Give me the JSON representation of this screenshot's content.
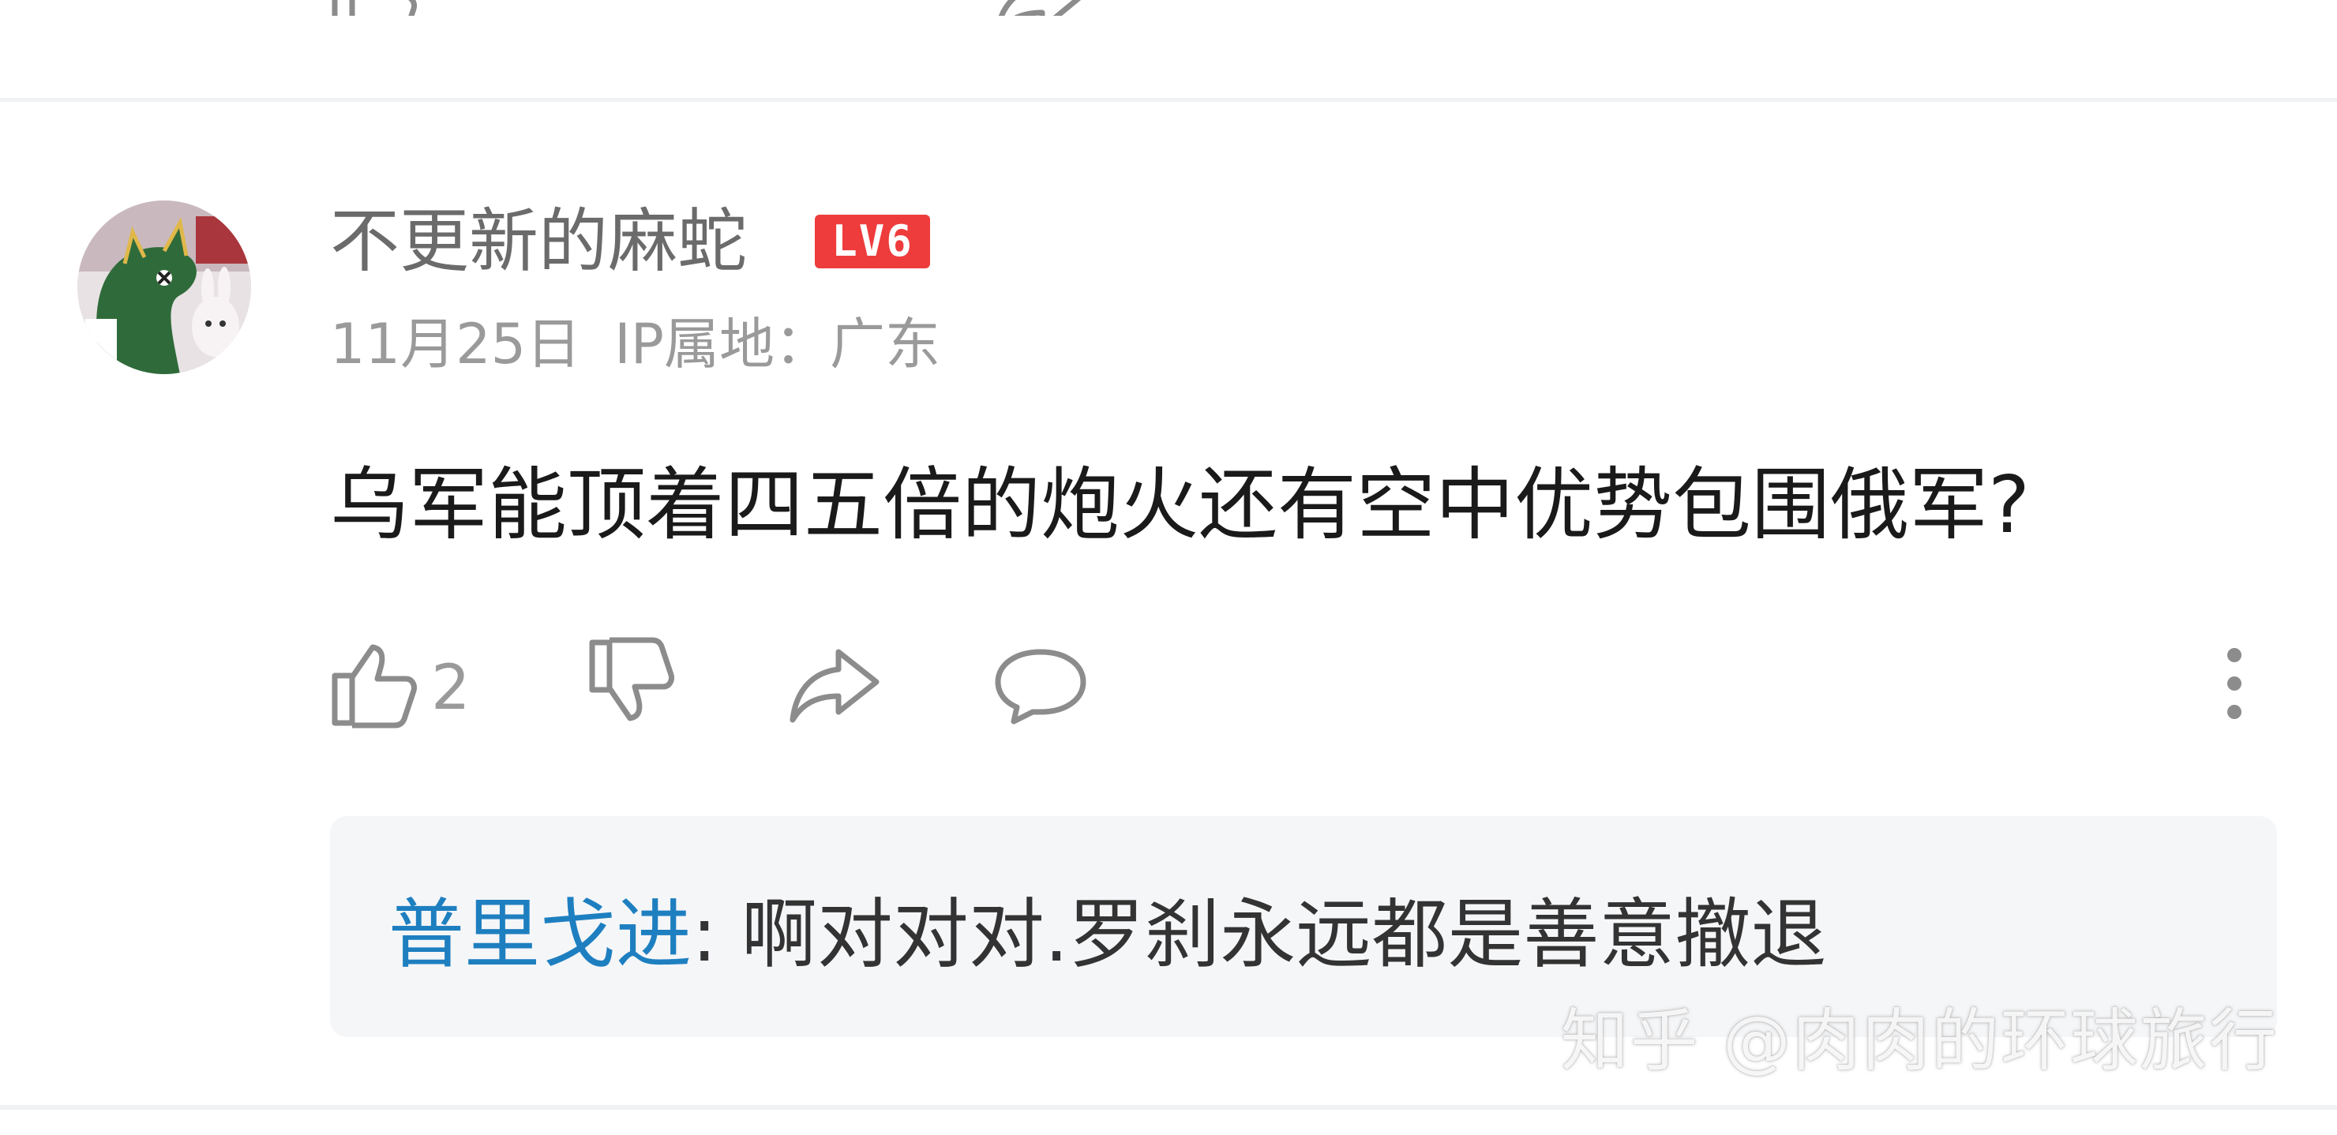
{
  "comment": {
    "username": "不更新的麻蛇",
    "level_badge": "LV6",
    "date": "11月25日",
    "ip_location": "IP属地：广东",
    "text": "乌军能顶着四五倍的炮火还有空中优势包围俄军?",
    "like_count": "2",
    "icons": [
      "thumbs-up-icon",
      "thumbs-down-icon",
      "share-icon",
      "comment-icon",
      "more-icon"
    ]
  },
  "reply": {
    "username": "普里戈进",
    "separator": ": ",
    "text": "啊对对对.罗刹永远都是善意撤退"
  },
  "watermark": "知乎 @肉肉的环球旅行",
  "colors": {
    "level_badge": "#ee3c3c",
    "reply_username": "#1e7fc0",
    "icon_gray": "#8c8c8c",
    "reply_background": "#f5f6f8"
  }
}
